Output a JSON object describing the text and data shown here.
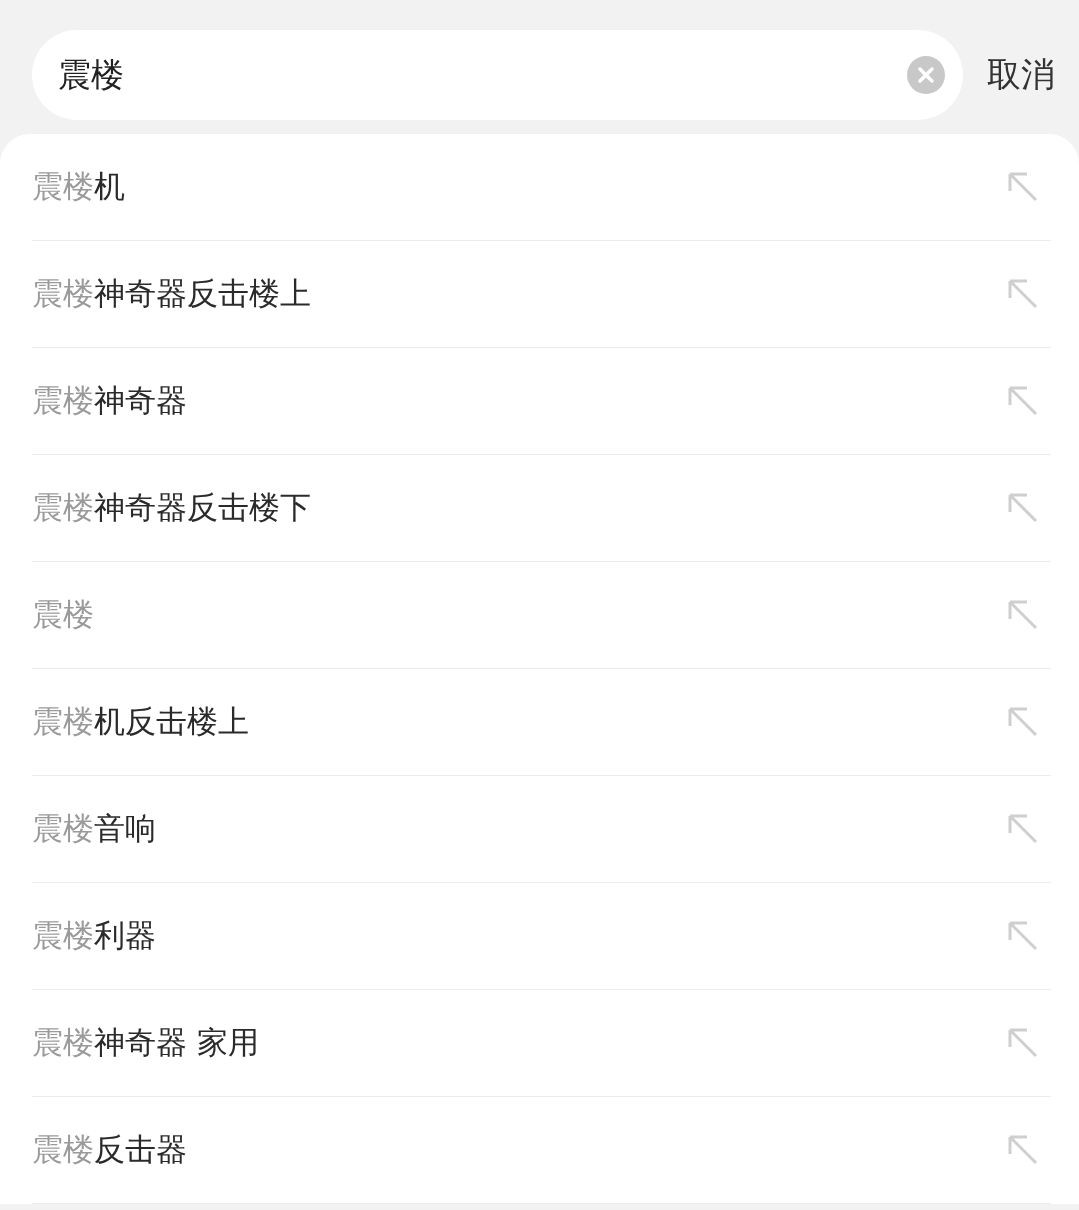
{
  "search": {
    "value": "震楼",
    "cancel": "取消"
  },
  "suggestions": [
    {
      "match": "震楼",
      "rest": "机"
    },
    {
      "match": "震楼",
      "rest": "神奇器反击楼上"
    },
    {
      "match": "震楼",
      "rest": "神奇器"
    },
    {
      "match": "震楼",
      "rest": "神奇器反击楼下"
    },
    {
      "match": "震楼"
    },
    {
      "match": "震楼",
      "rest": "机反击楼上"
    },
    {
      "match": "震楼",
      "rest": "音响"
    },
    {
      "match": "震楼",
      "rest": "利器"
    },
    {
      "match": "震楼",
      "rest": "神奇器 家用"
    },
    {
      "match": "震楼",
      "rest": "反击器"
    }
  ]
}
